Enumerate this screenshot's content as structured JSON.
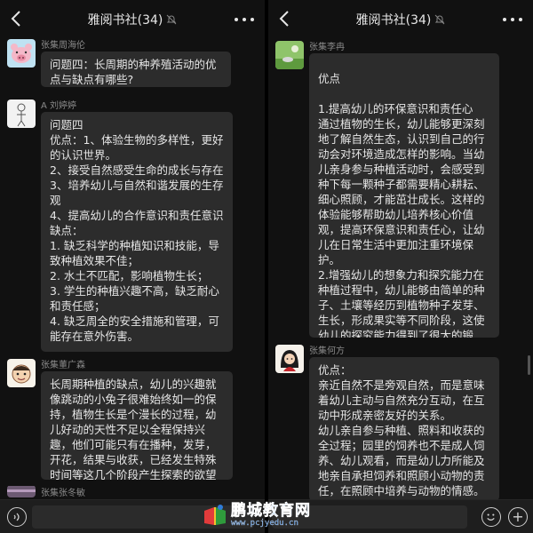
{
  "left": {
    "title": "雅阅书社(34)",
    "messages": [
      {
        "sender": "张集周海伦",
        "text": "问题四：长周期的种养殖活动的优点与缺点有哪些?"
      },
      {
        "sender": "A 刘婷婷",
        "text": "问题四\n优点：1、体验生物的多样性，更好的认识世界。\n2、接受自然感受生命的成长与存在\n3、培养幼儿与自然和谐发展的生存观\n4、提高幼儿的合作意识和责任意识\n缺点：\n1. 缺乏科学的种植知识和技能，导致种植效果不佳；\n2. 水土不匹配，影响植物生长；\n3. 学生的种植兴趣不高，缺乏耐心和责任感；\n4. 缺乏周全的安全措施和管理，可能存在意外伤害。"
      },
      {
        "sender": "张集董广森",
        "text": "长周期种植的缺点，幼儿的兴趣就像跳动的小兔子很难始终如一的保持，植物生长是个漫长的过程，幼儿好动的天性不足以全程保持兴趣，他们可能只有在播种，发芽，开花，结果与收获，已经发生特殊时间等这几个阶段产生探索的欲望"
      },
      {
        "sender": "张集张冬敏",
        "text": ""
      }
    ]
  },
  "right": {
    "title": "雅阅书社(34)",
    "messages": [
      {
        "sender": "张集李冉",
        "text": "优点\n\n1.提高幼儿的环保意识和责任心\n通过植物的生长，幼儿能够更深刻地了解自然生态，认识到自己的行动会对环境造成怎样的影响。当幼儿亲身参与种植活动时，会感受到种下每一颗种子都需要精心耕耘、细心照顾，才能茁壮成长。这样的体验能够帮助幼儿培养核心价值观，提高环保意识和责任心，让幼儿在日常生活中更加注重环境保护。\n2.增强幼儿的想象力和探究能力在种植过程中，幼儿能够由简单的种子、土壤等经历到植物种子发芽、生长，形成果实等不同阶段，这使幼儿的探究能力得到了很大的锻炼。"
      },
      {
        "sender": "张集何方",
        "text": "优点：\n亲近自然不是旁观自然，而是意味着幼儿主动与自然充分互动，在互动中形成亲密友好的关系。\n幼儿亲自参与种植、照料和收获的全过程；园里的饲养也不是成人饲养、幼儿观看，而是幼儿力所能及地亲自承担饲养和照顾小动物的责任，在照顾中培养与动物的情感。\n在亲近自然的过程中，获得感受和"
      }
    ]
  },
  "watermark": {
    "main": "鹏城教育网",
    "url": "www.pcjyedu.cn"
  },
  "colors": {
    "bubble": "#2c2c2c",
    "background": "#111111",
    "watermark": "#2f7cd8"
  }
}
